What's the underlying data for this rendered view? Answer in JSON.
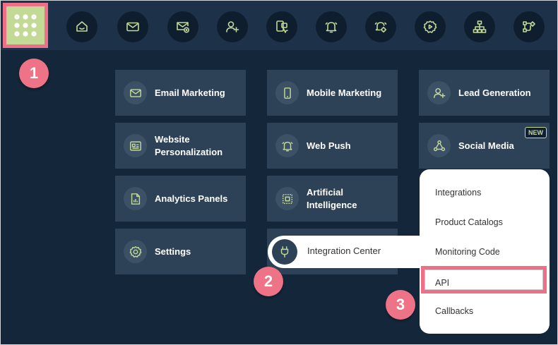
{
  "colors": {
    "background": "#14263a",
    "topbar": "#1d3148",
    "tile": "#2d4256",
    "accent_green": "#c3d996",
    "callout_pink": "#ee7387"
  },
  "topbar": {
    "icons": [
      {
        "name": "home-icon"
      },
      {
        "name": "mail-icon"
      },
      {
        "name": "mail-add-icon"
      },
      {
        "name": "add-user-icon"
      },
      {
        "name": "device-click-icon"
      },
      {
        "name": "bell-icon"
      },
      {
        "name": "bell-settings-icon"
      },
      {
        "name": "gear-play-icon"
      },
      {
        "name": "sitemap-icon"
      },
      {
        "name": "workflow-icon"
      }
    ]
  },
  "tiles": [
    {
      "label": "Email Marketing",
      "icon": "mail-icon"
    },
    {
      "label": "Mobile Marketing",
      "icon": "mobile-icon"
    },
    {
      "label": "Lead Generation",
      "icon": "add-user-icon"
    },
    {
      "label": "Website Personalization",
      "icon": "website-card-icon"
    },
    {
      "label": "Web Push",
      "icon": "bell-icon"
    },
    {
      "label": "Social Media",
      "icon": "share-nodes-icon",
      "badge": "NEW"
    },
    {
      "label": "Analytics Panels",
      "icon": "document-chart-icon"
    },
    {
      "label": "Artificial Intelligence",
      "icon": "chip-icon"
    },
    {
      "label": "Settings",
      "icon": "gear-icon"
    }
  ],
  "integration_center": {
    "label": "Integration Center",
    "icon": "plug-icon"
  },
  "submenu": {
    "items": [
      {
        "label": "Integrations"
      },
      {
        "label": "Product Catalogs"
      },
      {
        "label": "Monitoring Code"
      },
      {
        "label": "API",
        "highlighted": true
      },
      {
        "label": "Callbacks"
      }
    ]
  },
  "steps": [
    "1",
    "2",
    "3"
  ]
}
